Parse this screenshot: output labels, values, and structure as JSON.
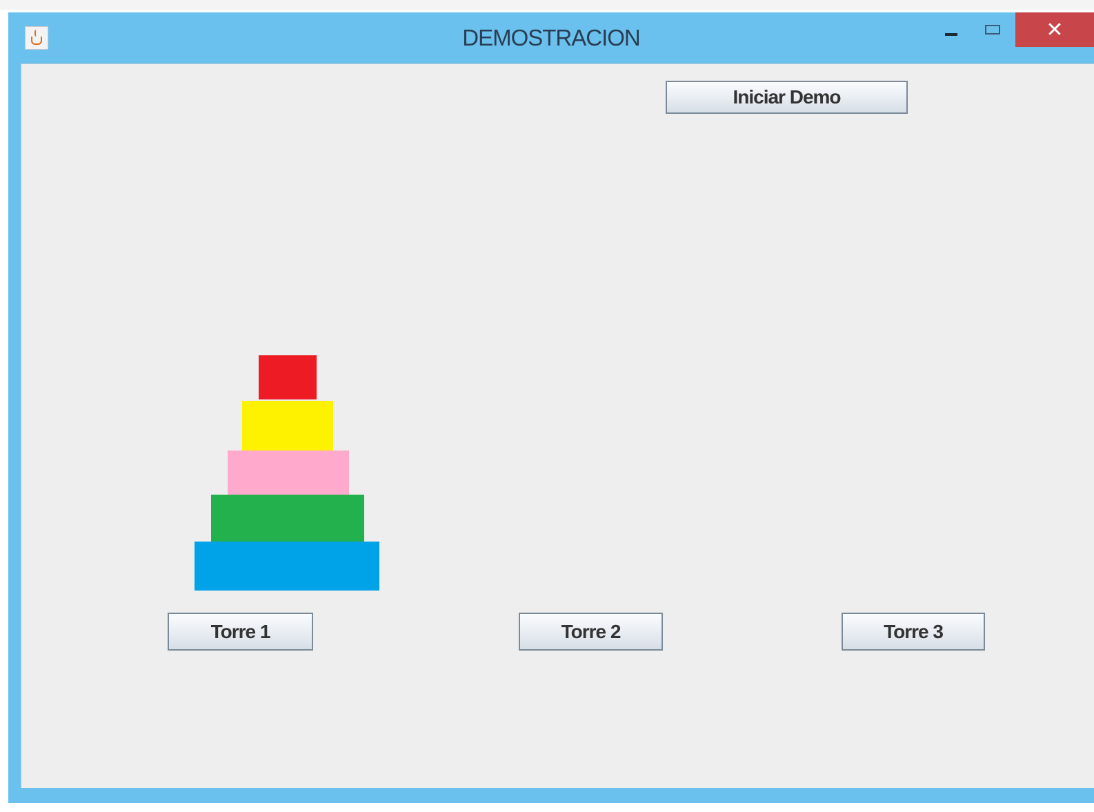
{
  "window": {
    "title": "DEMOSTRACION",
    "close_glyph": "✕"
  },
  "buttons": {
    "start_demo": "Iniciar Demo",
    "tower1": "Torre 1",
    "tower2": "Torre 2",
    "tower3": "Torre 3"
  },
  "towers": [
    {
      "name": "Torre 1",
      "disks_top_to_bottom": [
        {
          "size_rank": 1,
          "color": "#ed1c24"
        },
        {
          "size_rank": 2,
          "color": "#fff200"
        },
        {
          "size_rank": 3,
          "color": "#ffaacc"
        },
        {
          "size_rank": 4,
          "color": "#22b14c"
        },
        {
          "size_rank": 5,
          "color": "#00a2e8"
        }
      ]
    },
    {
      "name": "Torre 2",
      "disks_top_to_bottom": []
    },
    {
      "name": "Torre 3",
      "disks_top_to_bottom": []
    }
  ],
  "colors": {
    "titlebar": "#6ac1ee",
    "client_bg": "#eeeeee",
    "close_button": "#c8454a"
  }
}
